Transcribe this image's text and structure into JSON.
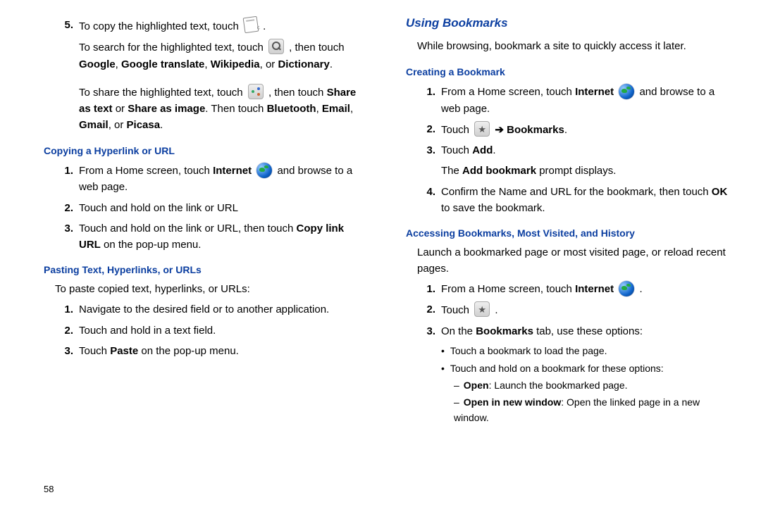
{
  "page_number": "58",
  "left": {
    "step5_a": "To copy the highlighted text, touch",
    "step5_a_end": ".",
    "step5_b_1": "To search for the highlighted text, touch",
    "step5_b_2": ", then touch",
    "step5_b_3": "Google",
    "step5_b_4": ", ",
    "step5_b_5": "Google translate",
    "step5_b_6": ", ",
    "step5_b_7": "Wikipedia",
    "step5_b_8": ", or ",
    "step5_b_9": "Dictionary",
    "step5_b_10": ".",
    "step5_c_1": "To share the highlighted text, touch",
    "step5_c_2": ", then touch ",
    "step5_c_3": "Share as text",
    "step5_c_4": " or ",
    "step5_c_5": "Share as image",
    "step5_c_6": ". Then touch ",
    "step5_c_7": "Bluetooth",
    "step5_c_8": ", ",
    "step5_c_9": "Email",
    "step5_c_10": ", ",
    "step5_c_11": "Gmail",
    "step5_c_12": ", or ",
    "step5_c_13": "Picasa",
    "step5_c_14": ".",
    "h_copy": "Copying a Hyperlink or URL",
    "copy1_a": "From a Home screen, touch ",
    "copy1_b": "Internet",
    "copy1_c": " and browse to a web page.",
    "copy2": "Touch and hold on the link or URL",
    "copy3_a": "Touch and hold on the link or URL, then touch ",
    "copy3_b": "Copy link URL",
    "copy3_c": " on the pop-up menu.",
    "h_paste": "Pasting Text, Hyperlinks, or URLs",
    "paste_intro": "To paste copied text, hyperlinks, or URLs:",
    "paste1": "Navigate to the desired field or to another application.",
    "paste2": "Touch and hold in a text field.",
    "paste3_a": "Touch ",
    "paste3_b": "Paste",
    "paste3_c": " on the pop-up menu."
  },
  "right": {
    "h_bookmarks": "Using Bookmarks",
    "bm_intro": "While browsing, bookmark a site to quickly access it later.",
    "h_create": "Creating a Bookmark",
    "c1_a": "From a Home screen, touch ",
    "c1_b": "Internet",
    "c1_c": " and browse to a web page.",
    "c2_a": "Touch ",
    "c2_arrow": " ➔ ",
    "c2_b": "Bookmarks",
    "c2_c": ".",
    "c3_a": "Touch ",
    "c3_b": "Add",
    "c3_c": ".",
    "c3_d_a": "The ",
    "c3_d_b": "Add bookmark",
    "c3_d_c": " prompt displays.",
    "c4_a": "Confirm the Name and URL for the bookmark, then touch ",
    "c4_b": "OK",
    "c4_c": " to save the bookmark.",
    "h_access": "Accessing Bookmarks, Most Visited, and History",
    "a_intro": "Launch a bookmarked page or most visited page, or reload recent pages.",
    "a1_a": "From a Home screen, touch ",
    "a1_b": "Internet",
    "a1_c": ".",
    "a2_a": "Touch ",
    "a2_b": ".",
    "a3_a": "On the ",
    "a3_b": "Bookmarks",
    "a3_c": " tab, use these options:",
    "bul1": "Touch a bookmark to load the page.",
    "bul2": "Touch and hold on a bookmark for these options:",
    "sub1_a": "Open",
    "sub1_b": ": Launch the bookmarked page.",
    "sub2_a": "Open in new window",
    "sub2_b": ": Open the linked page in a new window."
  }
}
